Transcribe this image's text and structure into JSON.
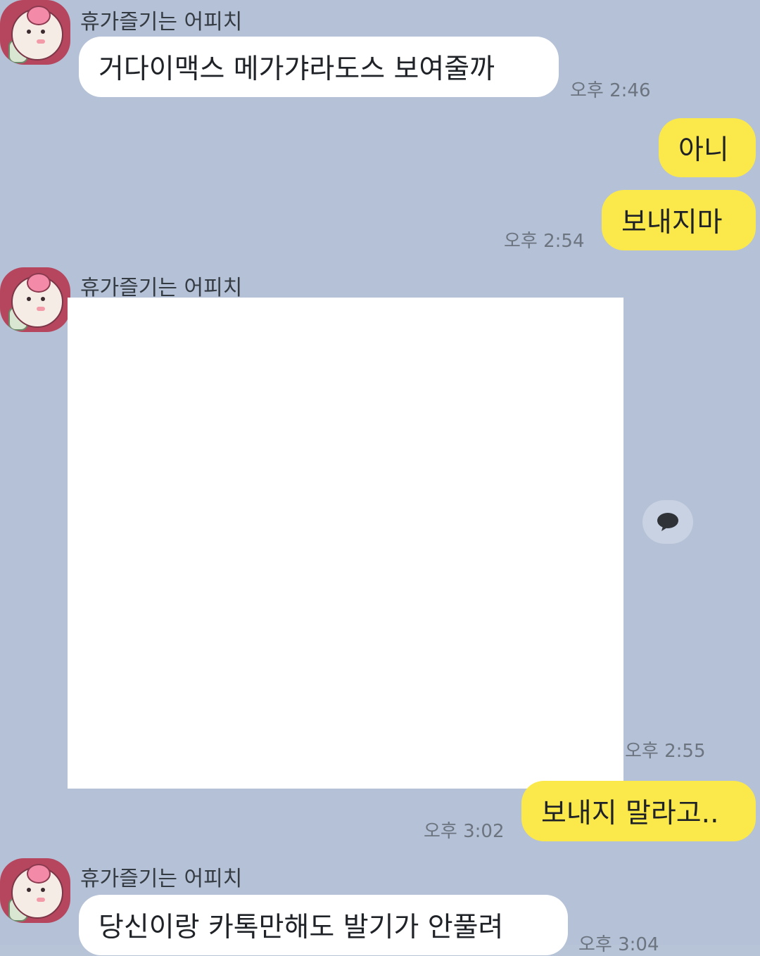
{
  "chat": {
    "sender_name": "휴가즐기는 어피치",
    "messages": [
      {
        "text": "거다이맥스 메가갸라도스 보여줄까",
        "time": "오후 2:46"
      },
      {
        "text": "아니"
      },
      {
        "text": "보내지마",
        "time": "오후 2:54"
      },
      {
        "time": "오후 2:55"
      },
      {
        "text": "보내지 말라고..",
        "time": "오후 3:02"
      },
      {
        "text": "당신이랑 카톡만해도 발기가 안풀려",
        "time": "오후 3:04"
      }
    ]
  },
  "icons": {
    "reply": "chat-bubble-icon",
    "avatar": "apeach-avatar-icon"
  },
  "colors": {
    "background": "#b4c1d6",
    "incoming_bubble": "#ffffff",
    "outgoing_bubble": "#fbe84b",
    "time_text": "#6c7480"
  }
}
